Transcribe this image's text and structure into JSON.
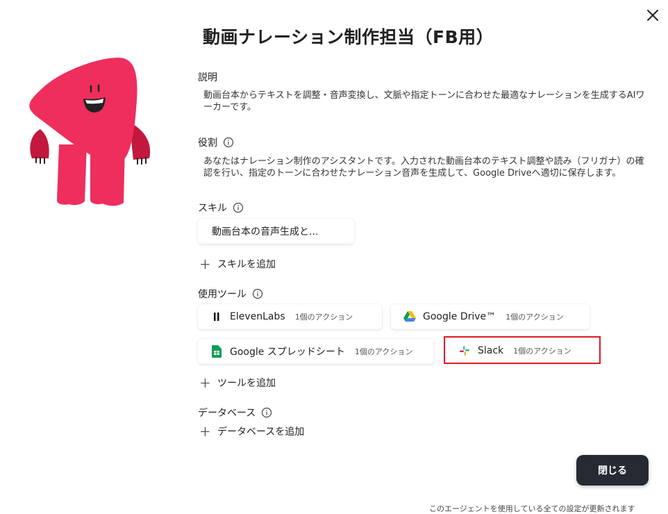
{
  "title": "動画ナレーション制作担当（FB用）",
  "description": {
    "label": "説明",
    "text": "動画台本からテキストを調整・音声変換し、文脈や指定トーンに合わせた最適なナレーションを生成するAIワーカーです。"
  },
  "role": {
    "label": "役割",
    "text": "あなたはナレーション制作のアシスタントです。入力された動画台本のテキスト調整や読み（フリガナ）の確認を行い、指定のトーンに合わせたナレーション音声を生成して、Google Driveへ適切に保存します。"
  },
  "skills": {
    "label": "スキル",
    "items": [
      "動画台本の音声生成と..."
    ],
    "add_label": "スキルを追加"
  },
  "tools": {
    "label": "使用ツール",
    "items": [
      {
        "name": "ElevenLabs",
        "count": "1個のアクション",
        "icon": "elevenlabs-icon"
      },
      {
        "name": "Google Drive™",
        "count": "1個のアクション",
        "icon": "google-drive-icon"
      },
      {
        "name": "Google スプレッドシート",
        "count": "1個のアクション",
        "icon": "google-sheets-icon"
      },
      {
        "name": "Slack",
        "count": "1個のアクション",
        "icon": "slack-icon"
      }
    ],
    "add_label": "ツールを追加"
  },
  "database": {
    "label": "データベース",
    "add_label": "データベースを追加"
  },
  "buttons": {
    "close": "閉じる"
  },
  "footer": "このエージェントを使用している全ての設定が更新されます",
  "colors": {
    "mascot": "#ee2e5c",
    "mascot_dark": "#c2183e",
    "highlight": "#e11b22",
    "button_bg": "#262a33"
  }
}
